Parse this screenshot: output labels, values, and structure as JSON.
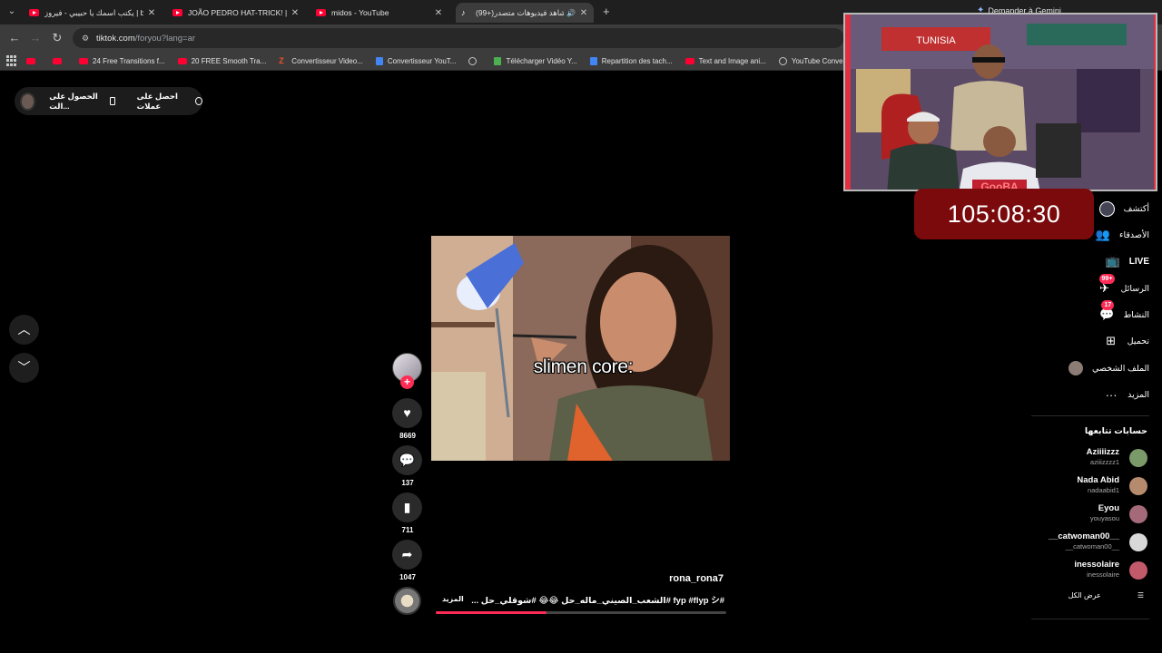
{
  "browser": {
    "tabs": [
      {
        "label": "يكتب اسمك يا حبيبي - فيروز | be",
        "icon": "youtube-icon"
      },
      {
        "label": "JOÃO PEDRO HAT-TRICK! | Che",
        "icon": "youtube-icon"
      },
      {
        "label": "midos - YouTube",
        "icon": "youtube-icon"
      },
      {
        "label": "(99+)شاهد فيديوهات متصدر",
        "icon": "tiktok-icon",
        "active": true
      }
    ],
    "gemini_label": "Demander à Gemini",
    "url_host": "tiktok.com",
    "url_path": "/foryou?lang=ar",
    "bookmarks": [
      {
        "label": "",
        "icon": "youtube-icon"
      },
      {
        "label": "",
        "icon": "youtube-icon"
      },
      {
        "label": "24 Free Transitions f...",
        "icon": "youtube-icon"
      },
      {
        "label": "20 FREE Smooth Tra...",
        "icon": "youtube-icon"
      },
      {
        "label": "Convertisseur Video...",
        "icon": "z-icon"
      },
      {
        "label": "Convertisseur YouT...",
        "icon": "converter-icon"
      },
      {
        "label": "",
        "icon": "globe-icon"
      },
      {
        "label": "Télécharger Vidéo Y...",
        "icon": "download-icon"
      },
      {
        "label": "Repartition des tach...",
        "icon": "doc-icon"
      },
      {
        "label": "Text and Image ani...",
        "icon": "youtube-icon"
      },
      {
        "label": "YouTube Converter...",
        "icon": "globe-icon"
      }
    ]
  },
  "promo": {
    "get_coins": "احصل على عملات",
    "get_app": "الحصول على الت..."
  },
  "video": {
    "caption": "slimen core:",
    "username": "rona_rona7",
    "description": "#fyp #flyp シ #الشعب_الصيني_ماله_حل 😂😂 #شوقلي_حل ...",
    "more_label": "المزيد",
    "progress": 0.38,
    "likes": "8669",
    "comments": "137",
    "saves": "711",
    "shares": "1047"
  },
  "stream": {
    "timer": "105:08:30",
    "banner_text": "TUNISIA",
    "logo_text": "GooBA"
  },
  "sidebar": {
    "items": [
      {
        "label": "أكتشف",
        "icon": "explore-avatar-icon"
      },
      {
        "label": "الأصدقاء",
        "icon": "friends-icon"
      },
      {
        "label": "LIVE",
        "icon": "live-icon"
      },
      {
        "label": "الرسائل",
        "icon": "messages-icon",
        "badge": "99+"
      },
      {
        "label": "النشاط",
        "icon": "activity-icon",
        "badge": "17"
      },
      {
        "label": "تحميل",
        "icon": "upload-icon"
      },
      {
        "label": "الملف الشخصي",
        "icon": "profile-avatar-icon"
      },
      {
        "label": "المزيد",
        "icon": "more-icon"
      }
    ],
    "following_title": "حسابات تتابعها",
    "accounts": [
      {
        "name": "Aziiiizzz",
        "handle": "aziiizzzz1",
        "color": "#7a9a6a"
      },
      {
        "name": "Nada Abid",
        "handle": "nadaabid1",
        "color": "#b68b6d"
      },
      {
        "name": "Eyou",
        "handle": "youyasou",
        "color": "#a56a7a"
      },
      {
        "name": "__catwoman00__",
        "handle": "__catwoman00__",
        "color": "#d8d8d8"
      },
      {
        "name": "inessolaire",
        "handle": "inessolaire",
        "color": "#c25a6a"
      }
    ],
    "see_all": "عرض الكل"
  },
  "colors": {
    "accent": "#fe2c55",
    "timer_bg": "#7a0a0c"
  }
}
